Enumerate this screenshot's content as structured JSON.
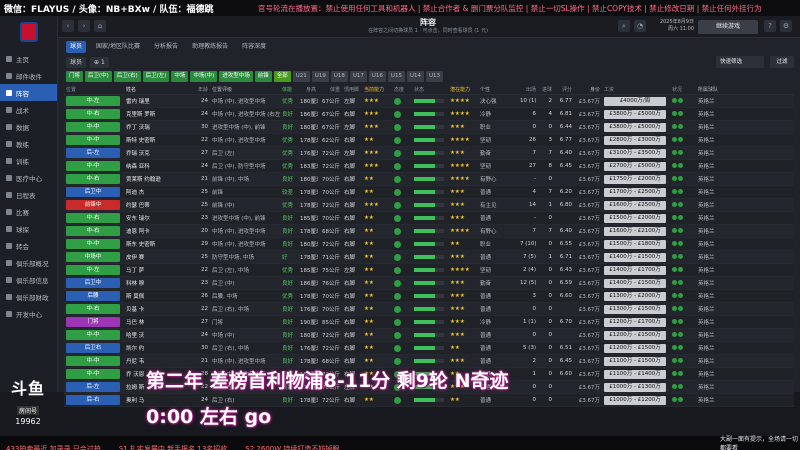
{
  "stream": {
    "left_text": "微信：FLAYUS / 头像：NB+BXw / 队伍：福德跳",
    "right_text": "官号轮流在播放置：禁止使用任何工具和机器人 | 禁止合作者 & 删门票分队监控 | 禁止一切SL操作 | 禁止COPY技术 | 禁止修改日期 | 禁止任何外挂行为"
  },
  "window": {
    "title": "阵容",
    "subtitle": "在阵容之间切换球员 1 · 可点击，同时查看球员 (1 元)",
    "date_line1": "2025年8月9日",
    "date_line2": "周六 11:00",
    "continue_label": "继续游戏"
  },
  "sidebar": {
    "items": [
      {
        "label": "主页"
      },
      {
        "label": "邮件收件"
      },
      {
        "label": "阵容"
      },
      {
        "label": "战术"
      },
      {
        "label": "数据"
      },
      {
        "label": "教练"
      },
      {
        "label": "训练"
      },
      {
        "label": "医疗中心"
      },
      {
        "label": "日程表"
      },
      {
        "label": "比赛"
      },
      {
        "label": "球探"
      },
      {
        "label": "转会"
      },
      {
        "label": "俱乐部概况"
      },
      {
        "label": "俱乐部信息"
      },
      {
        "label": "俱乐部财政"
      },
      {
        "label": "开发中心"
      }
    ],
    "active_index": 2
  },
  "tabs": [
    {
      "label": "球员"
    },
    {
      "label": "国家/地区队比赛"
    },
    {
      "label": "分析报告"
    },
    {
      "label": "助理教练报告"
    },
    {
      "label": "阵容深度"
    }
  ],
  "filters": [
    {
      "label": "球员"
    },
    {
      "label": "⊕ 1"
    }
  ],
  "fast_select": "快速筛选",
  "filter_label": "过滤",
  "position_chips": [
    "门将",
    "后卫(中)",
    "后卫(右)",
    "后卫(左)",
    "中场",
    "中场(中)",
    "进攻型中场",
    "前锋",
    "全部",
    "U21",
    "U19",
    "U18",
    "U17",
    "U16",
    "U15",
    "U14",
    "U13"
  ],
  "table": {
    "headers": [
      "位置",
      "姓名",
      "年龄",
      "位置评级",
      "体能",
      "身高",
      "体重",
      "惯用脚",
      "当前能力",
      "态度",
      "状态",
      "潜在能力",
      "个性",
      "出场",
      "进球",
      "评分",
      "身价",
      "工资",
      "状况",
      "所属球队"
    ],
    "rows": [
      {
        "pos": "中-左",
        "name": "雷内 瑞里",
        "age": "24",
        "rp": "中场 (中), 进攻型中场",
        "f": "优秀",
        "h": "180厘米",
        "w": "67公斤",
        "foot": "左脚",
        "ca": "★★★",
        "pa": "★★★★",
        "pers": "决心强",
        "apps": "10 (1)",
        "gls": "2",
        "rat": "6.77",
        "val": "£3.67万",
        "wage": "£4000万/周",
        "team": "英格兰"
      },
      {
        "pos": "中-右",
        "name": "克里斯 罗斯",
        "age": "24",
        "rp": "中场 (中), 进攻型中场 (右左中)",
        "f": "良好",
        "h": "186厘米",
        "w": "67公斤",
        "foot": "右脚",
        "ca": "★★★",
        "pa": "★★★★",
        "pers": "冷静",
        "apps": "6",
        "gls": "4",
        "rat": "6.81",
        "val": "£3.67万",
        "wage": "£3800万 - £5000万",
        "team": "英格兰"
      },
      {
        "pos": "中-中",
        "name": "乔丁 沃瑞",
        "age": "30",
        "rp": "进攻型中场 (中), 前锋",
        "f": "良好",
        "h": "180厘米",
        "w": "67公斤",
        "foot": "左脚",
        "ca": "★★★",
        "pa": "★★★",
        "pers": "职业",
        "apps": "0",
        "gls": "0",
        "rat": "6.44",
        "val": "£3.67万",
        "wage": "£3800万 - £5000万",
        "team": "英格兰"
      },
      {
        "pos": "中-中",
        "name": "斯特 史密斯",
        "age": "22",
        "rp": "中场 (中), 进攻型中场",
        "f": "优秀",
        "h": "178厘米",
        "w": "62公斤",
        "foot": "右脚",
        "ca": "★★",
        "pa": "★★★★",
        "pers": "坚韧",
        "apps": "26",
        "gls": "3",
        "rat": "6.77",
        "val": "£3.67万",
        "wage": "£2800万 - £3000万",
        "team": "英格兰"
      },
      {
        "pos": "后-左",
        "name": "乔瑞 沃克",
        "age": "27",
        "rp": "后卫 (左)",
        "f": "优秀",
        "h": "176厘米",
        "w": "72公斤",
        "foot": "左脚",
        "ca": "★★★",
        "pa": "★★★",
        "pers": "勤奋",
        "apps": "7",
        "gls": "7",
        "rat": "6.40",
        "val": "£3.67万",
        "wage": "£3100万 - £3500万",
        "team": "英格兰"
      },
      {
        "pos": "中-中",
        "name": "纳森 亚科",
        "age": "24",
        "rp": "后卫 (中), 防守型中场",
        "f": "优秀",
        "h": "183厘米",
        "w": "72公斤",
        "foot": "右脚",
        "ca": "★★★",
        "pa": "★★★★",
        "pers": "坚韧",
        "apps": "27",
        "gls": "8",
        "rat": "6.45",
        "val": "£3.67万",
        "wage": "£2700万 - £5000万",
        "team": "英格兰"
      },
      {
        "pos": "中-右",
        "name": "贾莱斯 约翰逊",
        "age": "21",
        "rp": "前锋 (中), 中场",
        "f": "良好",
        "h": "180厘米",
        "w": "70公斤",
        "foot": "右脚",
        "ca": "★★",
        "pa": "★★★★",
        "pers": "有野心",
        "apps": "-",
        "gls": "0",
        "rat": "",
        "val": "£3.67万",
        "wage": "£1750万 - £2000万",
        "team": "英格兰"
      },
      {
        "pos": "后卫中",
        "name": "阿迪 杰",
        "age": "25",
        "rp": "前锋",
        "f": "较差",
        "h": "178厘米",
        "w": "70公斤",
        "foot": "右脚",
        "ca": "★★",
        "pa": "★★★",
        "pers": "普通",
        "apps": "4",
        "gls": "7",
        "rat": "6.20",
        "val": "£3.67万",
        "wage": "£1700万 - £2500万",
        "team": "英格兰"
      },
      {
        "pos": "前锋中",
        "name": "约瑟 巴蒂",
        "age": "25",
        "rp": "前锋 (中)",
        "f": "优秀",
        "h": "178厘米",
        "w": "72公斤",
        "foot": "右脚",
        "ca": "★★★",
        "pa": "★★★",
        "pers": "有主见",
        "apps": "14",
        "gls": "1",
        "rat": "6.80",
        "val": "£3.67万",
        "wage": "£1600万 - £2500万",
        "team": "英格兰"
      },
      {
        "pos": "中-右",
        "name": "安东 瑞尔",
        "age": "23",
        "rp": "进攻型中场 (中), 前锋",
        "f": "良好",
        "h": "185厘米",
        "w": "70公斤",
        "foot": "右脚",
        "ca": "★★",
        "pa": "★★★",
        "pers": "普通",
        "apps": "-",
        "gls": "0",
        "rat": "",
        "val": "£3.67万",
        "wage": "£1500万 - £2000万",
        "team": "英格兰"
      },
      {
        "pos": "中-右",
        "name": "迪恩 阿卡",
        "age": "20",
        "rp": "中场 (中), 进攻型中场",
        "f": "良好",
        "h": "178厘米",
        "w": "68公斤",
        "foot": "右脚",
        "ca": "★★",
        "pa": "★★★★",
        "pers": "有野心",
        "apps": "7",
        "gls": "7",
        "rat": "6.40",
        "val": "£3.67万",
        "wage": "£1600万 - £2100万",
        "team": "英格兰"
      },
      {
        "pos": "中-中",
        "name": "斯东 史密斯",
        "age": "29",
        "rp": "中场 (中), 进攻型中场",
        "f": "良好",
        "h": "180厘米",
        "w": "72公斤",
        "foot": "右脚",
        "ca": "★★",
        "pa": "★★",
        "pers": "职业",
        "apps": "7 (10)",
        "gls": "0",
        "rat": "6.55",
        "val": "£3.67万",
        "wage": "£1500万 - £1800万",
        "team": "英格兰"
      },
      {
        "pos": "中场中",
        "name": "皮伊 赛",
        "age": "25",
        "rp": "防守型中场, 中场",
        "f": "好",
        "h": "178厘米",
        "w": "71公斤",
        "foot": "右脚",
        "ca": "★★",
        "pa": "★★★",
        "pers": "普通",
        "apps": "7 (5)",
        "gls": "1",
        "rat": "6.71",
        "val": "£3.67万",
        "wage": "£1400万 - £1500万",
        "team": "英格兰"
      },
      {
        "pos": "中-左",
        "name": "马丁 萨",
        "age": "22",
        "rp": "后卫 (左), 中场",
        "f": "优秀",
        "h": "185厘米",
        "w": "75公斤",
        "foot": "左脚",
        "ca": "★★",
        "pa": "★★★★",
        "pers": "坚韧",
        "apps": "2 (4)",
        "gls": "0",
        "rat": "6.43",
        "val": "£3.67万",
        "wage": "£1400万 - £1700万",
        "team": "英格兰"
      },
      {
        "pos": "后卫中",
        "name": "科林 穆",
        "age": "23",
        "rp": "后卫 (中)",
        "f": "良好",
        "h": "186厘米",
        "w": "76公斤",
        "foot": "右脚",
        "ca": "★★",
        "pa": "★★★",
        "pers": "勤奋",
        "apps": "12 (5)",
        "gls": "0",
        "rat": "6.59",
        "val": "£3.67万",
        "wage": "£1400万 - £1500万",
        "team": "英格兰"
      },
      {
        "pos": "后腰",
        "name": "斯 莫佩",
        "age": "26",
        "rp": "后腰, 中场",
        "f": "优秀",
        "h": "178厘米",
        "w": "70公斤",
        "foot": "右脚",
        "ca": "★★",
        "pa": "★★★",
        "pers": "普通",
        "apps": "3",
        "gls": "0",
        "rat": "6.60",
        "val": "£3.67万",
        "wage": "£1300万 - £2000万",
        "team": "英格兰"
      },
      {
        "pos": "中-右",
        "name": "贝基 卡",
        "age": "22",
        "rp": "后卫 (右), 中场",
        "f": "良好",
        "h": "176厘米",
        "w": "70公斤",
        "foot": "右脚",
        "ca": "★★",
        "pa": "★★★",
        "pers": "普通",
        "apps": "0",
        "gls": "0",
        "rat": "",
        "val": "£3.67万",
        "wage": "£1300万 - £1500万",
        "team": "英格兰"
      },
      {
        "pos": "门将",
        "name": "马巴 林",
        "age": "27",
        "rp": "门将",
        "f": "良好",
        "h": "190厘米",
        "w": "85公斤",
        "foot": "右脚",
        "ca": "★★",
        "pa": "★★★",
        "pers": "冷静",
        "apps": "1 (1)",
        "gls": "0",
        "rat": "6.70",
        "val": "£3.67万",
        "wage": "£1200万 - £1700万",
        "team": "英格兰"
      },
      {
        "pos": "中-中",
        "name": "哈里 沃",
        "age": "24",
        "rp": "中场 (中)",
        "f": "良好",
        "h": "180厘米",
        "w": "72公斤",
        "foot": "右脚",
        "ca": "★★",
        "pa": "★★★",
        "pers": "普通",
        "apps": "0",
        "gls": "0",
        "rat": "",
        "val": "£3.67万",
        "wage": "£1200万 - £1500万",
        "team": "英格兰"
      },
      {
        "pos": "后卫右",
        "name": "凯尔 约",
        "age": "30",
        "rp": "后卫 (右), 中场",
        "f": "良好",
        "h": "176厘米",
        "w": "72公斤",
        "foot": "右脚",
        "ca": "★★",
        "pa": "★★",
        "pers": "普通",
        "apps": "5 (3)",
        "gls": "0",
        "rat": "6.51",
        "val": "£3.67万",
        "wage": "£1200万 - £1500万",
        "team": "英格兰"
      },
      {
        "pos": "中-中",
        "name": "丹尼 韦",
        "age": "21",
        "rp": "中场 (中), 进攻型中场",
        "f": "良好",
        "h": "178厘米",
        "w": "68公斤",
        "foot": "右脚",
        "ca": "★★",
        "pa": "★★★",
        "pers": "普通",
        "apps": "2",
        "gls": "0",
        "rat": "6.45",
        "val": "£3.67万",
        "wage": "£1100万 - £1500万",
        "team": "英格兰"
      },
      {
        "pos": "中-中",
        "name": "乔 沃恩",
        "age": "28",
        "rp": "中场 (中), 进攻型中场",
        "f": "良好",
        "h": "180厘米",
        "w": "72公斤",
        "foot": "右脚",
        "ca": "★★",
        "pa": "★★",
        "pers": "普通",
        "apps": "1",
        "gls": "0",
        "rat": "6.60",
        "val": "£3.67万",
        "wage": "£1100万 - £1400万",
        "team": "英格兰"
      },
      {
        "pos": "后-左",
        "name": "拉姆 斯",
        "age": "22",
        "rp": "后卫 (左)",
        "f": "良好",
        "h": "176厘米",
        "w": "70公斤",
        "foot": "左脚",
        "ca": "★★",
        "pa": "★★★",
        "pers": "普通",
        "apps": "0",
        "gls": "0",
        "rat": "",
        "val": "£3.67万",
        "wage": "£1000万 - £1300万",
        "team": "英格兰"
      },
      {
        "pos": "后-右",
        "name": "奥利 马",
        "age": "24",
        "rp": "后卫 (右)",
        "f": "良好",
        "h": "178厘米",
        "w": "72公斤",
        "foot": "右脚",
        "ca": "★★",
        "pa": "★★",
        "pers": "普通",
        "apps": "0",
        "gls": "0",
        "rat": "",
        "val": "£3.67万",
        "wage": "£1000万 - £1200万",
        "team": "英格兰"
      }
    ]
  },
  "overlay": {
    "caption_line1": "第二年 差榜首利物浦8-11分 剩9轮 N奇迹",
    "caption_line2": "0:00 左右  go",
    "logo_text": "斗鱼",
    "logo_sub": "房间号",
    "room_number": "19962"
  },
  "ticker": {
    "items": [
      "433拍卖最近 加录录 只会过拍",
      "S1 扎实发展中 新手报名 13名招收",
      "S2 2600W 持续打造不妨掉眼"
    ]
  },
  "right_info": "大副一面有提示，全场请一切都要看"
}
